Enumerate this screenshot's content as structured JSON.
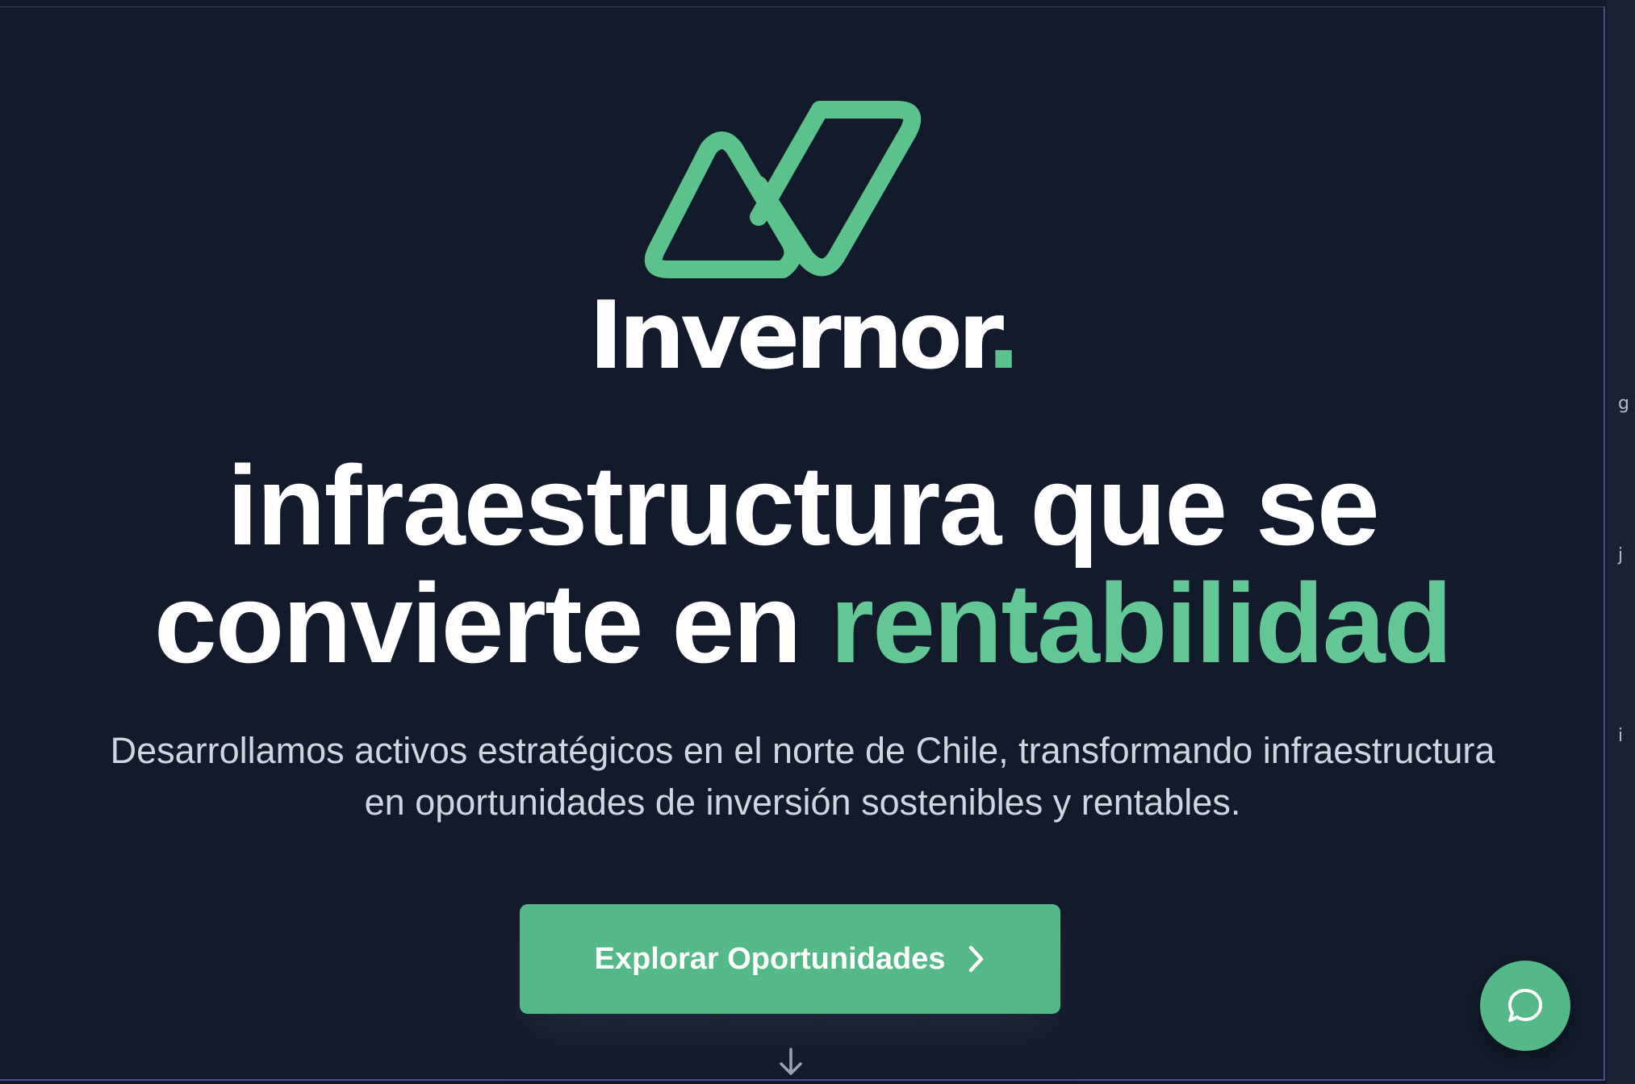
{
  "brand": {
    "name": "Invernor",
    "dot": ".",
    "accent_color": "#5cc28b"
  },
  "hero": {
    "headline_line1": "infraestructura que se",
    "headline_line2_prefix": "convierte en ",
    "headline_accent": "rentabilidad",
    "subtitle_line1": "Desarrollamos activos estratégicos en el norte de Chile, transformando infraestructura",
    "subtitle_line2": "en oportunidades de inversión sostenibles y rentables."
  },
  "cta": {
    "label": "Explorar Oportunidades",
    "icon": "chevron-right-icon",
    "color": "#55b888"
  },
  "scroll_indicator": {
    "icon": "arrow-down-icon"
  },
  "chat": {
    "icon": "chat-bubble-icon"
  },
  "side_strip": {
    "glyphs": [
      "g",
      "j",
      "i"
    ]
  }
}
